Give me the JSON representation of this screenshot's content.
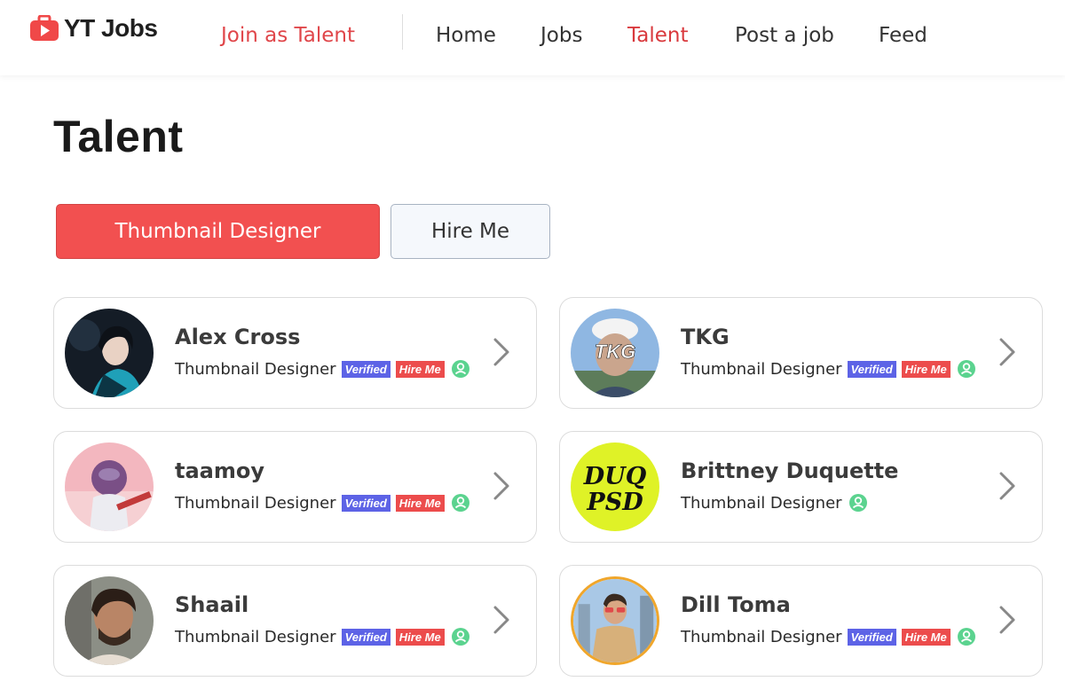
{
  "header": {
    "brand": "YT Jobs",
    "join_link": "Join as Talent",
    "nav": [
      "Home",
      "Jobs",
      "Talent",
      "Post a job",
      "Feed"
    ],
    "active_nav": "Talent",
    "accent_color": "#e0464a"
  },
  "page": {
    "title": "Talent"
  },
  "filters": {
    "selected": "Thumbnail Designer",
    "other": "Hire Me"
  },
  "talent": [
    {
      "name": "Alex Cross",
      "role": "Thumbnail Designer",
      "verified": "Verified",
      "hire": "Hire Me",
      "avatar": "avatar-dark-illustration"
    },
    {
      "name": "TKG",
      "role": "Thumbnail Designer",
      "verified": "Verified",
      "hire": "Hire Me",
      "avatar": "avatar-tkg-photo",
      "avatar_text": "TKG"
    },
    {
      "name": "taamoy",
      "role": "Thumbnail Designer",
      "verified": "Verified",
      "hire": "Hire Me",
      "avatar": "avatar-pink-illustration"
    },
    {
      "name": "Brittney Duquette",
      "role": "Thumbnail Designer",
      "avatar": "avatar-duq-logo",
      "avatar_text": "DUQ PSD"
    },
    {
      "name": "Shaail",
      "role": "Thumbnail Designer",
      "verified": "Verified",
      "hire": "Hire Me",
      "avatar": "avatar-photo"
    },
    {
      "name": "Dill Toma",
      "role": "Thumbnail Designer",
      "verified": "Verified",
      "hire": "Hire Me",
      "avatar": "avatar-photo"
    }
  ]
}
